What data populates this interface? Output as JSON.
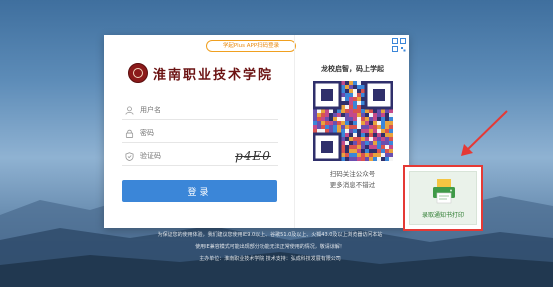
{
  "app_badge": "学起Plus APP扫码登录",
  "school_name": "淮南职业技术学院",
  "fields": {
    "username_placeholder": "用户名",
    "password_placeholder": "密码",
    "captcha_placeholder": "验证码",
    "captcha_text": "p4E0"
  },
  "login_label": "登录",
  "qr_panel": {
    "slogan": "龙校启智，码上学起",
    "scan_line1": "扫码关注公众号",
    "scan_line2": "更多消息不错过"
  },
  "notice": {
    "label": "录取通知书打印"
  },
  "footer": {
    "line1": "为保证您的使用体验，我们建议您使用IE9.0以上、谷歌51.0及以上、火狐43.0及以上浏览器访问本站",
    "line2": "使用IE兼容模式可能出现部分功能无法正常使用的情况，敬请谅解！",
    "line3": "主办单位：淮南职业技术学院  技术支持：弘成科技发展有限公司"
  },
  "colors": {
    "primary": "#3b86d8",
    "highlight": "#e53935",
    "school_red": "#6b1212",
    "badge_orange": "#e88a10"
  },
  "icons": [
    "user-icon",
    "lock-icon",
    "shield-icon",
    "qr-code-icon",
    "printer-icon",
    "arrow-icon"
  ]
}
